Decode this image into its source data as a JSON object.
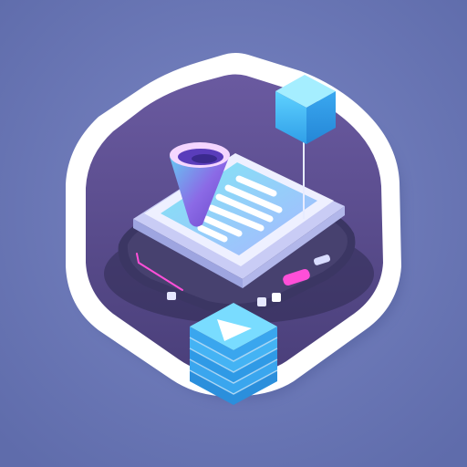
{
  "colors": {
    "background": "#6572b0",
    "background_light": "#7885c2",
    "frame_outer": "#ffffff",
    "frame_inner": "#5d4f8f",
    "base_dark": "#3f3a66",
    "board_face": "#e8ecff",
    "screen_cyan": "#7fe8f4",
    "screen_blue": "#9fd0ff",
    "doc_lines": "#ffffff",
    "funnel_top": "#f2c9ff",
    "funnel_violet": "#7b55d8",
    "funnel_cyan": "#61d4f4",
    "cube_blue": "#3fb8f8",
    "cube_light": "#8de7ff",
    "accent_magenta": "#ff4fd8"
  },
  "icons": {
    "frame": "rounded-hexagon-frame",
    "document": "document-screen-icon",
    "funnel": "funnel-icon",
    "cube_top": "floating-cube-icon",
    "stack": "stacked-layers-icon",
    "play": "play-triangle-icon"
  }
}
